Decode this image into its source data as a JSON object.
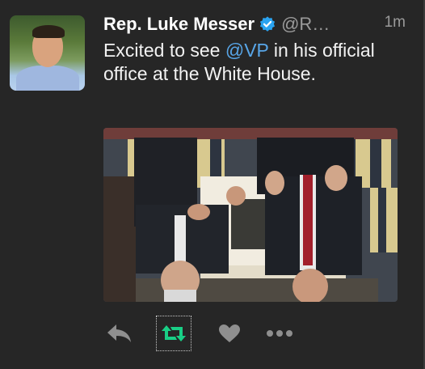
{
  "tweet": {
    "author_name": "Rep. Luke Messer",
    "handle": "@R…",
    "timestamp": "1m",
    "text_before": "Excited to see ",
    "mention": "@VP",
    "text_after": " in his official office at the White House."
  },
  "icons": {
    "verified": "verified-badge-icon",
    "reply": "reply-icon",
    "retweet": "retweet-icon",
    "like": "heart-icon",
    "more": "more-icon"
  },
  "colors": {
    "background": "#262626",
    "mention": "#58a6e8",
    "verified": "#2aa3f0",
    "retweet_active": "#19cf86",
    "action_icon": "#8f8f8f"
  }
}
